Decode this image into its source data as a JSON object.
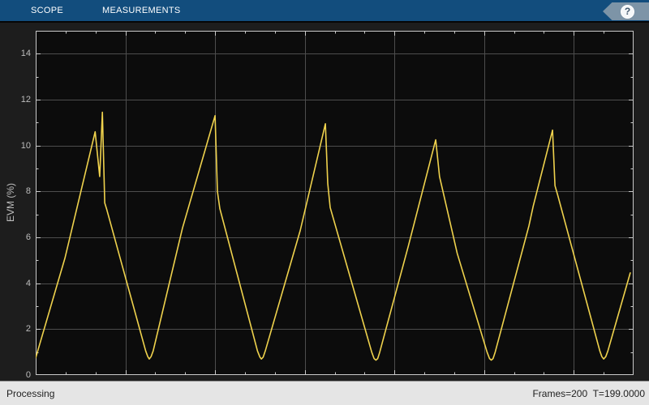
{
  "toolbar": {
    "tabs": [
      {
        "label": "SCOPE"
      },
      {
        "label": "MEASUREMENTS"
      }
    ],
    "help_label": "?"
  },
  "status": {
    "left": "Processing",
    "right": "Frames=200  T=199.0000"
  },
  "colors": {
    "toolbar_bg": "#124D7D",
    "toolbar_text": "#FFFFFF",
    "help_arrow": "#7D94A7",
    "help_circle": "#F5F7F9",
    "help_mark": "#41586E",
    "figure_bg": "#1D1D1D",
    "plot_bg": "#0C0C0C",
    "grid": "#4D4D4D",
    "axis": "#C9C9C9",
    "tick_label": "#BDBDBD",
    "line": "#EFD24D",
    "status_bg": "#E5E5E5",
    "status_text": "#1F1F1F",
    "status_border": "#8A8A8A"
  },
  "chart_data": {
    "type": "line",
    "title": "",
    "xlabel": "",
    "ylabel": "EVM (%)",
    "xlim": [
      0,
      200
    ],
    "ylim": [
      0,
      15
    ],
    "x_major_tick": 30,
    "x_minor_tick": 10,
    "y_major_tick": 2,
    "y_minor_tick": 1,
    "yticks": [
      0,
      2,
      4,
      6,
      8,
      10,
      12,
      14
    ],
    "yticklabels": [
      "0",
      "2",
      "4",
      "6",
      "8",
      "10",
      "12",
      "14"
    ],
    "grid": true,
    "legend_position": "none",
    "line_color": "#EFD24D",
    "series": [
      {
        "name": "EVM (%)",
        "points": [
          [
            0,
            0.75
          ],
          [
            9.8,
            5.1
          ],
          [
            19.9,
            10.6
          ],
          [
            21.4,
            8.65
          ],
          [
            22.3,
            11.45
          ],
          [
            23.1,
            7.5
          ],
          [
            23.7,
            7.25
          ],
          [
            36.8,
            1.05
          ],
          [
            37.5,
            0.8
          ],
          [
            38.0,
            0.7
          ],
          [
            38.6,
            0.8
          ],
          [
            39.3,
            1.05
          ],
          [
            49.1,
            6.4
          ],
          [
            60.0,
            11.3
          ],
          [
            60.8,
            8.0
          ],
          [
            61.6,
            7.25
          ],
          [
            74.2,
            1.05
          ],
          [
            75.0,
            0.78
          ],
          [
            75.5,
            0.7
          ],
          [
            76.1,
            0.78
          ],
          [
            76.8,
            1.05
          ],
          [
            88.5,
            6.3
          ],
          [
            96.9,
            10.95
          ],
          [
            97.7,
            8.35
          ],
          [
            98.5,
            7.3
          ],
          [
            112.4,
            1.0
          ],
          [
            113.2,
            0.72
          ],
          [
            113.8,
            0.65
          ],
          [
            114.4,
            0.72
          ],
          [
            115.1,
            1.0
          ],
          [
            124.6,
            5.6
          ],
          [
            133.8,
            10.25
          ],
          [
            135.1,
            8.65
          ],
          [
            141.0,
            5.3
          ],
          [
            151.0,
            1.0
          ],
          [
            151.8,
            0.72
          ],
          [
            152.4,
            0.65
          ],
          [
            153.0,
            0.72
          ],
          [
            153.7,
            1.0
          ],
          [
            165.0,
            6.5
          ],
          [
            166.4,
            7.35
          ],
          [
            172.9,
            10.67
          ],
          [
            173.7,
            8.25
          ],
          [
            174.6,
            7.85
          ],
          [
            188.7,
            1.05
          ],
          [
            189.4,
            0.8
          ],
          [
            190.0,
            0.7
          ],
          [
            190.7,
            0.8
          ],
          [
            191.4,
            1.05
          ],
          [
            198.9,
            4.45
          ]
        ]
      }
    ]
  }
}
